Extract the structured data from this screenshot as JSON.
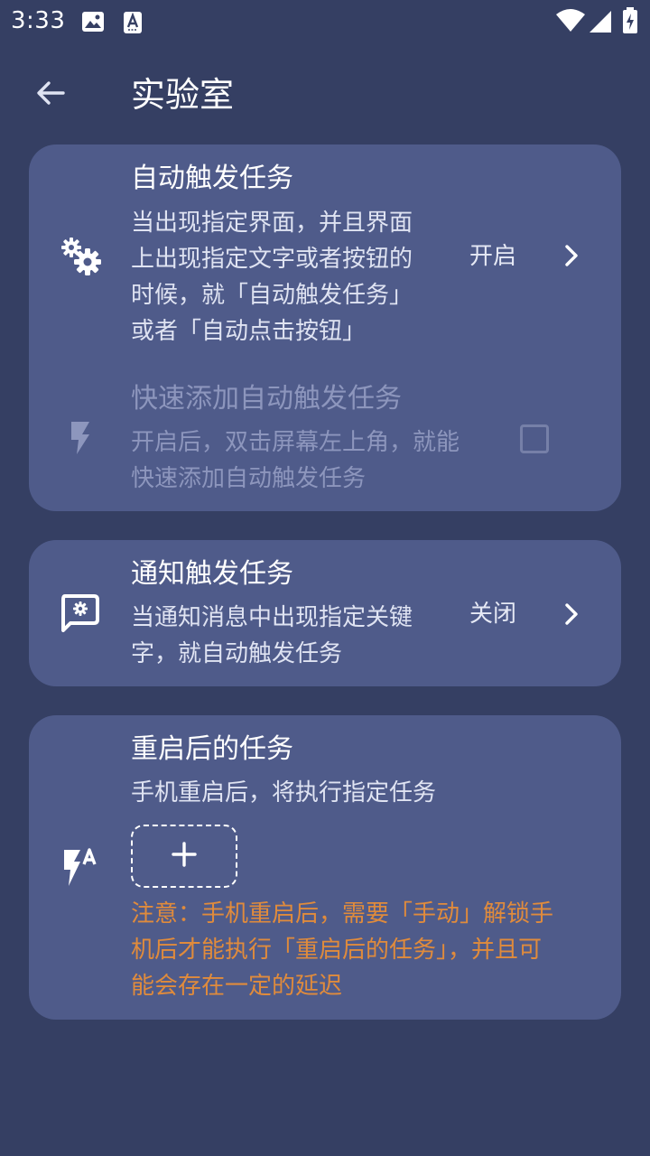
{
  "status_bar": {
    "time": "3:33",
    "icons": [
      "image-icon",
      "font-icon",
      "wifi-icon",
      "signal-icon",
      "battery-charging-icon"
    ]
  },
  "app_bar": {
    "back_icon": "arrow-left-icon",
    "title": "实验室"
  },
  "cards": {
    "auto_trigger": {
      "icon": "gears-icon",
      "title": "自动触发任务",
      "description": "当出现指定界面，并且界面\n上出现指定文字或者按钮的\n时候，就「自动触发任务」\n或者「自动点击按钮」",
      "value": "开启"
    },
    "quick_add": {
      "icon": "flash-icon",
      "title": "快速添加自动触发任务",
      "description": "开启后，双击屏幕左上角，就能\n快速添加自动触发任务",
      "checked": false,
      "enabled": false
    },
    "notification_trigger": {
      "icon": "settings-message-icon",
      "title": "通知触发任务",
      "description": "当通知消息中出现指定关键\n字，就自动触发任务",
      "value": "关闭"
    },
    "reboot_task": {
      "icon": "flash-auto-icon",
      "title": "重启后的任务",
      "description": "手机重启后，将执行指定任务",
      "add_icon": "plus-icon",
      "note": "注意：手机重启后，需要「手动」解锁手\n机后才能执行「重启后的任务」，并且可\n能会存在一定的延迟"
    }
  },
  "colors": {
    "background": "#353f63",
    "card": "#4f5b8a",
    "warning_text": "#e08b3c",
    "disabled_text": "#8d96bd"
  }
}
